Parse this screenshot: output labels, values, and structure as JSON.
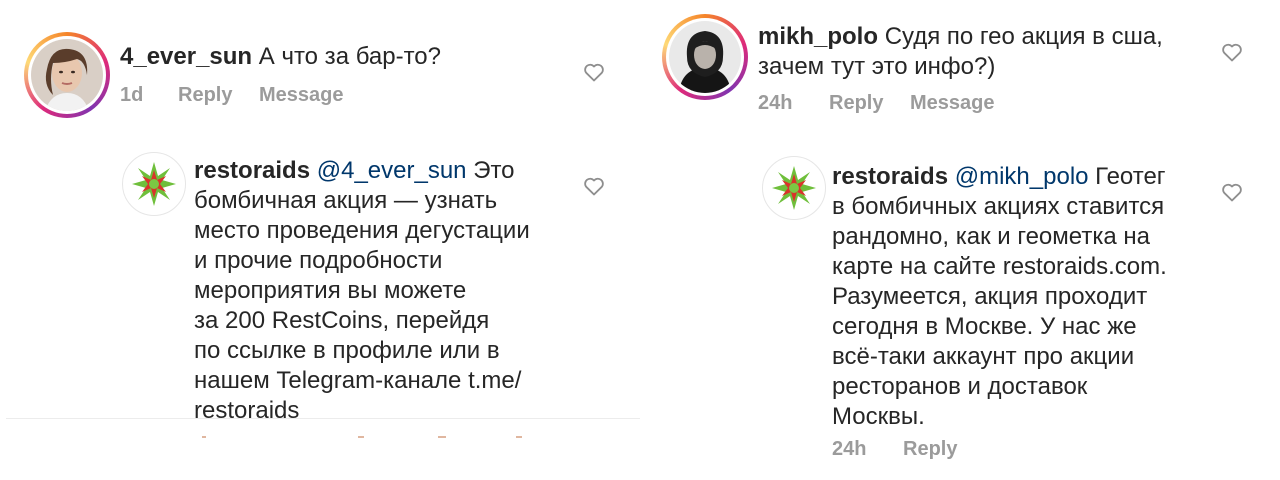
{
  "left": {
    "comment": {
      "username": "4_ever_sun",
      "text": "А что за бар-то?",
      "time": "1d",
      "reply_label": "Reply",
      "message_label": "Message"
    },
    "reply": {
      "username": "restoraids",
      "mention": "@4_ever_sun",
      "lines": [
        "Это",
        "бомбичная акция — узнать",
        "место проведения дегустации",
        "и прочие подробности",
        "мероприятия вы можете",
        "за 200 RestCoins, перейдя",
        "по ссылке в профиле или в",
        "нашем Telegram-канале t.me/",
        "restoraids"
      ]
    }
  },
  "right": {
    "comment": {
      "username": "mikh_polo",
      "line1": "Судя по гео акция в сша,",
      "line2": "зачем тут это инфо?)",
      "time": "24h",
      "reply_label": "Reply",
      "message_label": "Message"
    },
    "reply": {
      "username": "restoraids",
      "mention": "@mikh_polo",
      "lines": [
        "Геотег",
        "в бомбичных акциях ставится",
        "рандомно, как и геометка на",
        "карте на сайте restoraids.com.",
        "Разумеется, акция проходит",
        "сегодня в Москве. У нас же",
        "всё-таки аккаунт про акции",
        "ресторанов и доставок",
        "Москвы."
      ],
      "time": "24h",
      "reply_label": "Reply"
    }
  },
  "icons": {
    "heart": "heart-outline-icon",
    "restoraids_logo": "restoraids-logo-icon"
  },
  "colors": {
    "text": "#262626",
    "meta": "#9b9b9b",
    "mention": "#00376b",
    "logo_green": "#6fbf3b",
    "logo_red": "#d9342b"
  }
}
